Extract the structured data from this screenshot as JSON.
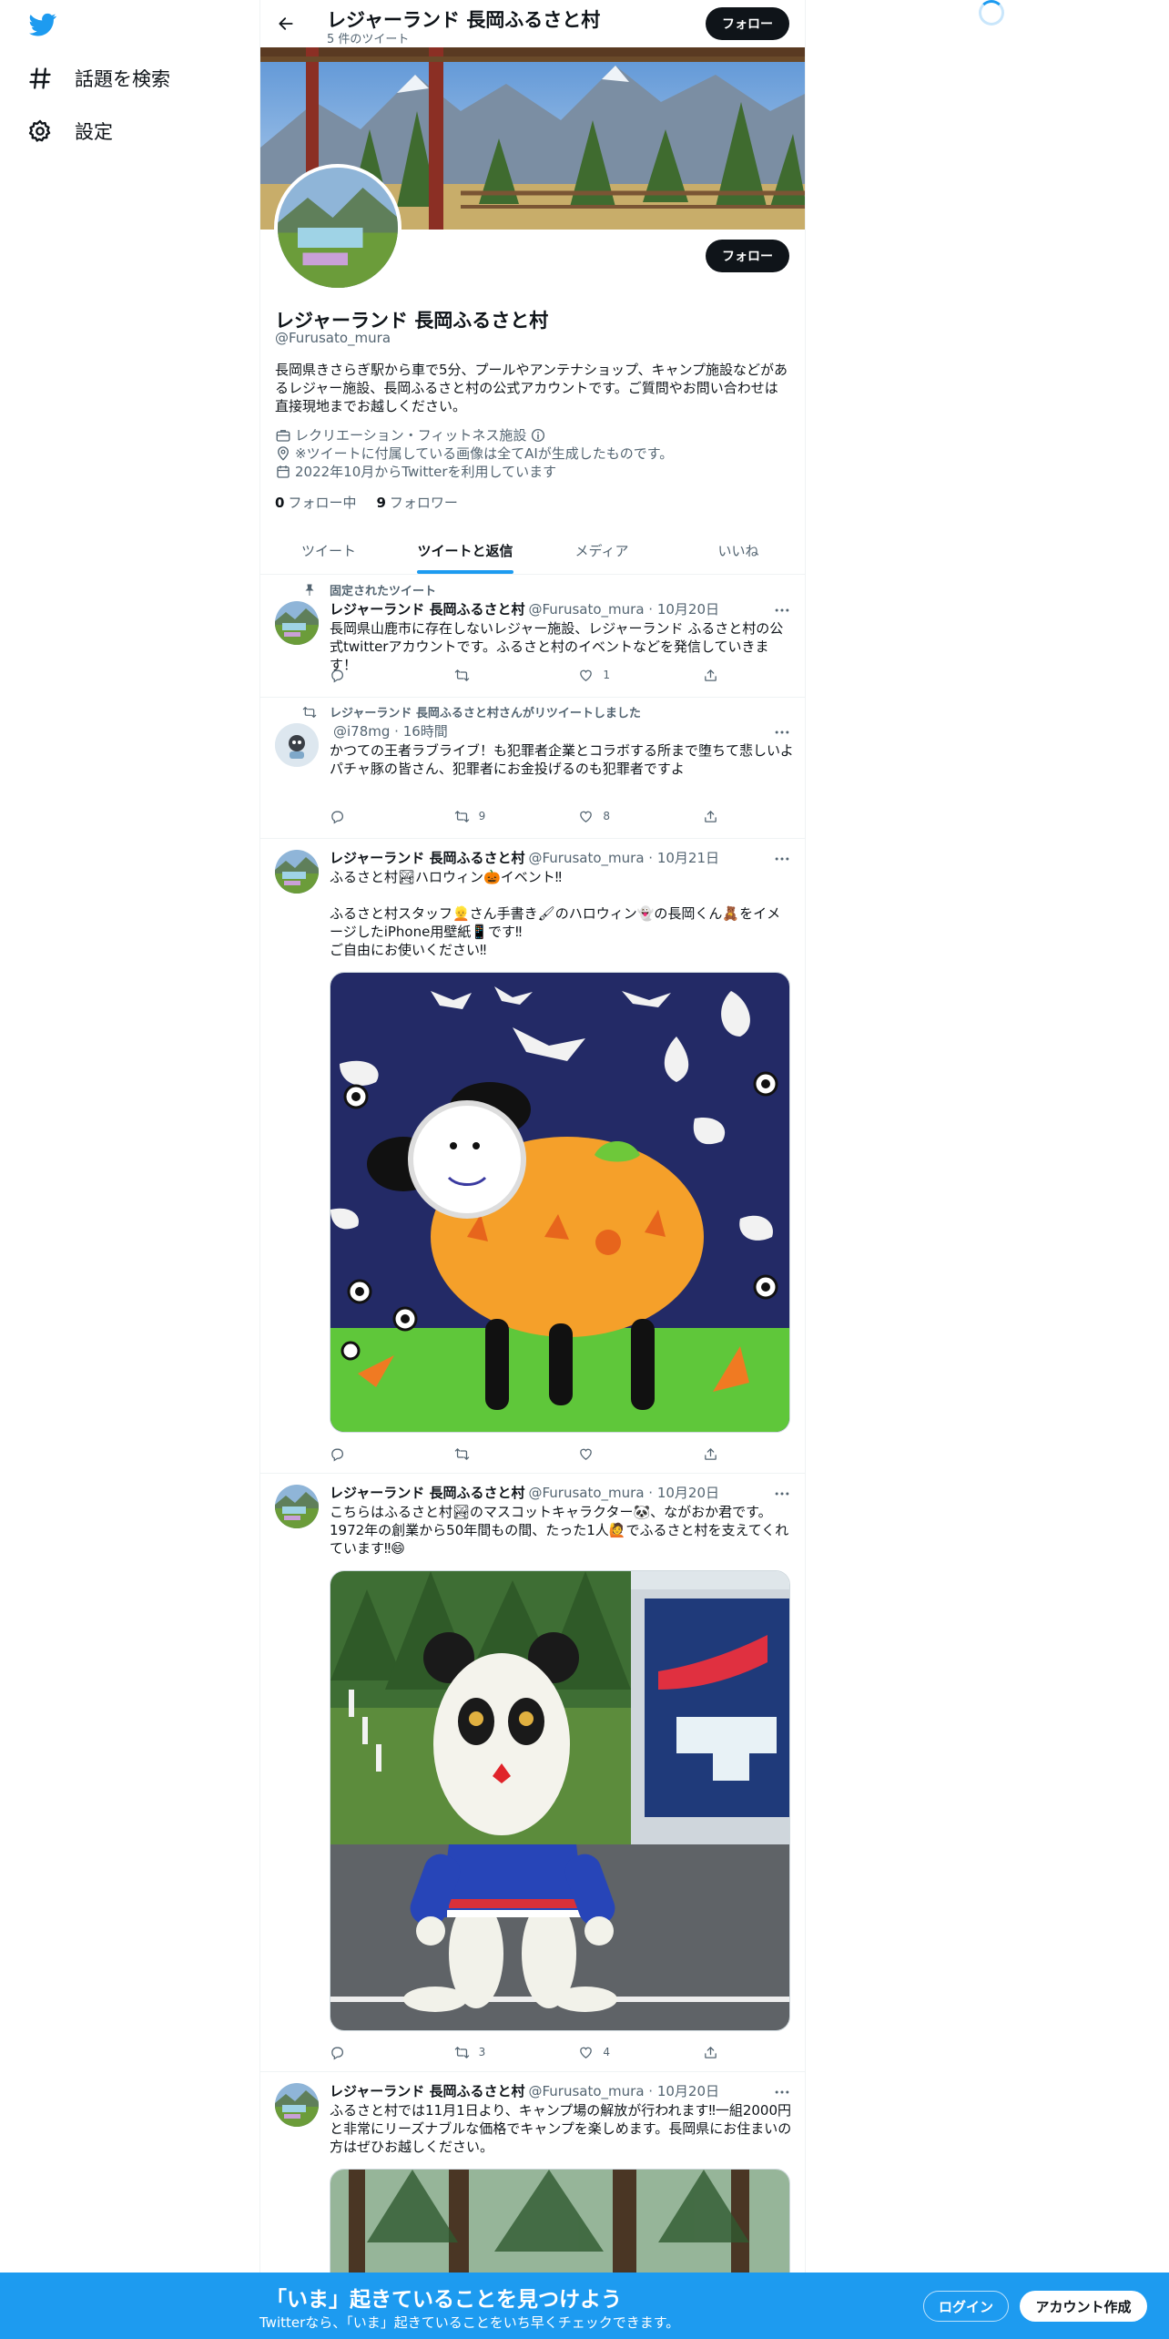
{
  "nav": {
    "logo_icon": "twitter-bird-icon",
    "items": [
      {
        "icon": "hashtag-icon",
        "label": "話題を検索"
      },
      {
        "icon": "gear-icon",
        "label": "設定"
      }
    ]
  },
  "header": {
    "title": "レジャーランド 長岡ふるさと村",
    "tweet_count": "5 件のツイート",
    "follow_label": "フォロー"
  },
  "profile": {
    "name": "レジャーランド 長岡ふるさと村",
    "handle": "@Furusato_mura",
    "follow_label": "フォロー",
    "bio": "長岡県きさらぎ駅から車で5分、プールやアンテナショップ、キャンプ施設などがあるレジャー施設、長岡ふるさと村の公式アカウントです。ご質問やお問い合わせは直接現地までお越しください。",
    "category": "レクリエーション・フィットネス施設",
    "location": "※ツイートに付属している画像は全てAIが生成したものです。",
    "joined": "2022年10月からTwitterを利用しています",
    "following_count": "0",
    "following_label": "フォロー中",
    "followers_count": "9",
    "followers_label": "フォロワー"
  },
  "tabs": [
    "ツイート",
    "ツイートと返信",
    "メディア",
    "いいね"
  ],
  "active_tab": "ツイートと返信",
  "tweets": [
    {
      "context": "固定されたツイート",
      "name": "レジャーランド 長岡ふるさと村",
      "handle": "@Furusato_mura",
      "time": "10月20日",
      "text": "長岡県山鹿市に存在しないレジャー施設、レジャーランド ふるさと村の公式twitterアカウントです。ふるさと村のイベントなどを発信していきます！",
      "retweets": "",
      "likes": "1"
    },
    {
      "context": "レジャーランド 長岡ふるさと村さんがリツイートしました",
      "name": "",
      "handle": "@i78mg",
      "time": "16時間",
      "text": "かつての王者ラブライブ！も犯罪者企業とコラボする所まで堕ちて悲しいよ\nパチャ豚の皆さん、犯罪者にお金投げるのも犯罪者ですよ",
      "retweets": "9",
      "likes": "8"
    },
    {
      "context": "",
      "name": "レジャーランド 長岡ふるさと村",
      "handle": "@Furusato_mura",
      "time": "10月21日",
      "text": "ふるさと村🏞ハロウィン🎃イベント‼\n\nふるさと村スタッフ👱さん手書き🖌のハロウィン👻の長岡くん🧸をイメージしたiPhone用壁紙📱です‼\nご自由にお使いください‼",
      "retweets": "",
      "likes": ""
    },
    {
      "context": "",
      "name": "レジャーランド 長岡ふるさと村",
      "handle": "@Furusato_mura",
      "time": "10月20日",
      "text": "こちらはふるさと村🏞のマスコットキャラクター🐼、ながおか君です。1972年の創業から50年間もの間、たった1人🙋でふるさと村を支えてくれています‼😄",
      "retweets": "3",
      "likes": "4"
    },
    {
      "context": "",
      "name": "レジャーランド 長岡ふるさと村",
      "handle": "@Furusato_mura",
      "time": "10月20日",
      "text": "ふるさと村では11月1日より、キャンプ場の解放が行われます‼一組2000円と非常にリーズナブルな価格でキャンプを楽しめます。長岡県にお住まいの方はぜひお越しください。",
      "retweets": "",
      "likes": ""
    }
  ],
  "bottom_bar": {
    "title": "「いま」起きていることを見つけよう",
    "subtitle": "Twitterなら、「いま」起きていることをいち早くチェックできます。",
    "login_label": "ログイン",
    "signup_label": "アカウント作成"
  },
  "colors": {
    "accent": "#1d9bf0",
    "text": "#0f1419",
    "secondary": "#536471",
    "border": "#eff3f4"
  }
}
